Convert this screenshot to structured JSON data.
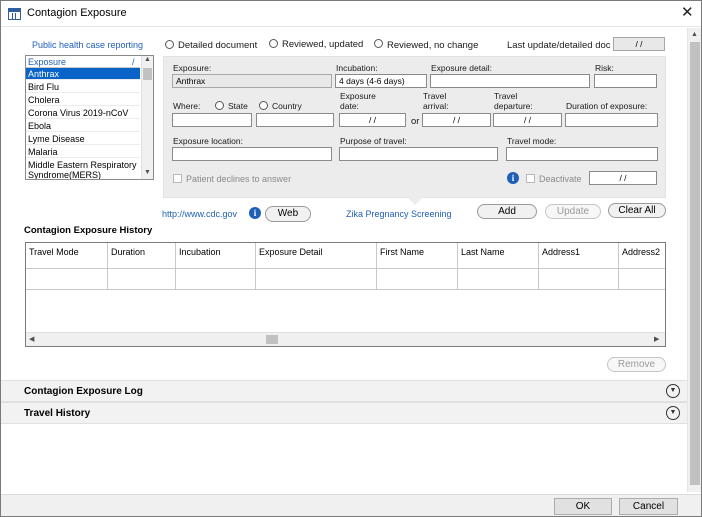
{
  "window": {
    "title": "Contagion Exposure"
  },
  "left": {
    "link": "Public health case reporting",
    "list_header": "Exposure",
    "list_header_mark": "/",
    "items": [
      "Anthrax",
      "Bird Flu",
      "Cholera",
      "Corona Virus 2019-nCoV",
      "Ebola",
      "Lyme Disease",
      "Malaria",
      "Middle Eastern Respiratory",
      "Syndrome(MERS)"
    ],
    "selected": "Anthrax"
  },
  "doc_status": {
    "detailed": "Detailed document",
    "reviewed_updated": "Reviewed, updated",
    "reviewed_no_change": "Reviewed, no change",
    "last_update_label": "Last update/detailed doc",
    "last_update_value": " / /"
  },
  "form": {
    "exposure_label": "Exposure:",
    "exposure_value": "Anthrax",
    "incubation_label": "Incubation:",
    "incubation_value": "4 days (4-6 days)",
    "exposure_detail_label": "Exposure detail:",
    "risk_label": "Risk:",
    "where_label": "Where:",
    "state_label": "State",
    "country_label": "Country",
    "exposure_date_label_1": "Exposure",
    "exposure_date_label_2": "date:",
    "exposure_date_value": "/ /",
    "or_label": "or",
    "travel_arrival_label_1": "Travel",
    "travel_arrival_label_2": "arrival:",
    "travel_arrival_value": "/ /",
    "travel_departure_label_1": "Travel",
    "travel_departure_label_2": "departure:",
    "travel_departure_value": "/ /",
    "duration_label": "Duration of exposure:",
    "exposure_location_label": "Exposure location:",
    "purpose_label": "Purpose of travel:",
    "travel_mode_label": "Travel mode:",
    "declines_label": "Patient declines to answer",
    "deactivate_label": "Deactivate",
    "deactivate_date": "/ /"
  },
  "links": {
    "cdc": "http://www.cdc.gov",
    "web_button": "Web",
    "zika": "Zika Pregnancy Screening"
  },
  "actions": {
    "add": "Add",
    "update": "Update",
    "clear_all": "Clear All",
    "remove": "Remove"
  },
  "history": {
    "title": "Contagion Exposure History",
    "columns": [
      "Travel Mode",
      "Duration",
      "Incubation",
      "Exposure Detail",
      "First Name",
      "Last Name",
      "Address1",
      "Address2"
    ]
  },
  "sections": {
    "log": "Contagion Exposure Log",
    "travel_history": "Travel History"
  },
  "footer": {
    "ok": "OK",
    "cancel": "Cancel"
  },
  "icons": {
    "window": "table-icon",
    "close": "close-icon",
    "info": "info-icon",
    "expand": "chevron-down-icon"
  }
}
